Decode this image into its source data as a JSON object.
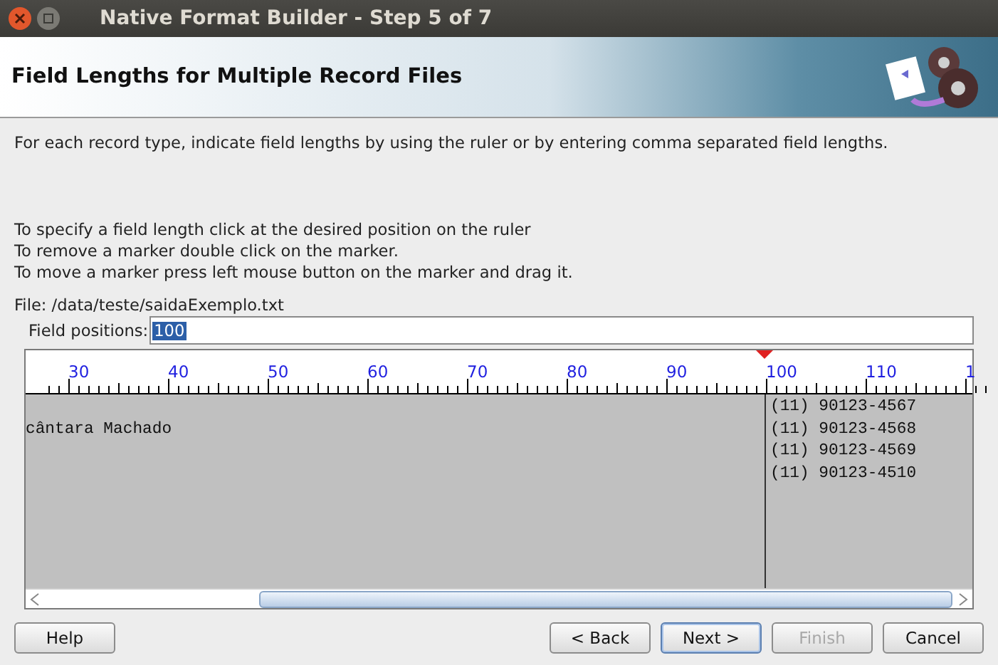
{
  "window": {
    "title": "Native Format Builder - Step 5 of 7"
  },
  "header": {
    "title": "Field Lengths for Multiple Record Files"
  },
  "intro": "For each record type, indicate field lengths by using the ruler or by entering comma separated field lengths.",
  "instructions": [
    "To specify a field length click at the desired position on the ruler",
    "To remove a marker double click on the marker.",
    "To move a marker press left mouse button on the marker and drag it."
  ],
  "file": "File: /data/teste/saidaExemplo.txt",
  "field_positions": {
    "label": "Field positions:",
    "value": "100"
  },
  "ruler": {
    "labels": [
      "30",
      "40",
      "50",
      "60",
      "70",
      "80",
      "90",
      "100",
      "110",
      "1"
    ]
  },
  "preview": {
    "rows": [
      {
        "column_2": "(11) 90123-4567"
      },
      {
        "column_1": "cântara Machado",
        "column_2": "(11) 90123-4568"
      },
      {
        "column_2": "(11) 90123-4569"
      },
      {
        "column_2": "(11) 90123-4510"
      }
    ]
  },
  "buttons": [
    {
      "label": "Help",
      "kind": "left",
      "disabled": false,
      "focused": false
    },
    {
      "label": "< Back",
      "kind": "right",
      "disabled": false,
      "focused": false
    },
    {
      "label": "Next >",
      "kind": "right",
      "disabled": false,
      "focused": true
    },
    {
      "label": "Finish",
      "kind": "right",
      "disabled": true,
      "focused": false
    },
    {
      "label": "Cancel",
      "kind": "right",
      "disabled": false,
      "focused": false
    }
  ]
}
